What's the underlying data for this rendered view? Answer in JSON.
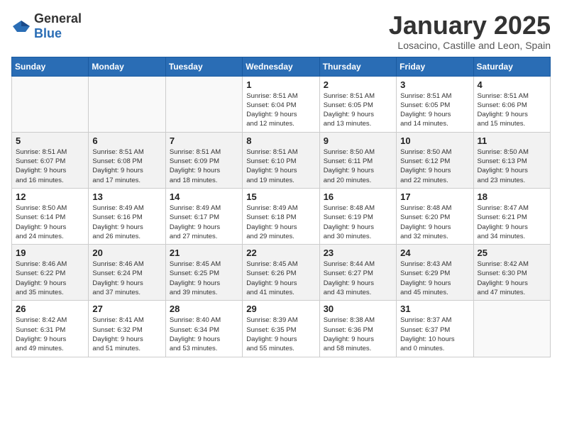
{
  "logo": {
    "general": "General",
    "blue": "Blue"
  },
  "header": {
    "month": "January 2025",
    "location": "Losacino, Castille and Leon, Spain"
  },
  "weekdays": [
    "Sunday",
    "Monday",
    "Tuesday",
    "Wednesday",
    "Thursday",
    "Friday",
    "Saturday"
  ],
  "weeks": [
    [
      {
        "day": "",
        "info": ""
      },
      {
        "day": "",
        "info": ""
      },
      {
        "day": "",
        "info": ""
      },
      {
        "day": "1",
        "info": "Sunrise: 8:51 AM\nSunset: 6:04 PM\nDaylight: 9 hours\nand 12 minutes."
      },
      {
        "day": "2",
        "info": "Sunrise: 8:51 AM\nSunset: 6:05 PM\nDaylight: 9 hours\nand 13 minutes."
      },
      {
        "day": "3",
        "info": "Sunrise: 8:51 AM\nSunset: 6:05 PM\nDaylight: 9 hours\nand 14 minutes."
      },
      {
        "day": "4",
        "info": "Sunrise: 8:51 AM\nSunset: 6:06 PM\nDaylight: 9 hours\nand 15 minutes."
      }
    ],
    [
      {
        "day": "5",
        "info": "Sunrise: 8:51 AM\nSunset: 6:07 PM\nDaylight: 9 hours\nand 16 minutes."
      },
      {
        "day": "6",
        "info": "Sunrise: 8:51 AM\nSunset: 6:08 PM\nDaylight: 9 hours\nand 17 minutes."
      },
      {
        "day": "7",
        "info": "Sunrise: 8:51 AM\nSunset: 6:09 PM\nDaylight: 9 hours\nand 18 minutes."
      },
      {
        "day": "8",
        "info": "Sunrise: 8:51 AM\nSunset: 6:10 PM\nDaylight: 9 hours\nand 19 minutes."
      },
      {
        "day": "9",
        "info": "Sunrise: 8:50 AM\nSunset: 6:11 PM\nDaylight: 9 hours\nand 20 minutes."
      },
      {
        "day": "10",
        "info": "Sunrise: 8:50 AM\nSunset: 6:12 PM\nDaylight: 9 hours\nand 22 minutes."
      },
      {
        "day": "11",
        "info": "Sunrise: 8:50 AM\nSunset: 6:13 PM\nDaylight: 9 hours\nand 23 minutes."
      }
    ],
    [
      {
        "day": "12",
        "info": "Sunrise: 8:50 AM\nSunset: 6:14 PM\nDaylight: 9 hours\nand 24 minutes."
      },
      {
        "day": "13",
        "info": "Sunrise: 8:49 AM\nSunset: 6:16 PM\nDaylight: 9 hours\nand 26 minutes."
      },
      {
        "day": "14",
        "info": "Sunrise: 8:49 AM\nSunset: 6:17 PM\nDaylight: 9 hours\nand 27 minutes."
      },
      {
        "day": "15",
        "info": "Sunrise: 8:49 AM\nSunset: 6:18 PM\nDaylight: 9 hours\nand 29 minutes."
      },
      {
        "day": "16",
        "info": "Sunrise: 8:48 AM\nSunset: 6:19 PM\nDaylight: 9 hours\nand 30 minutes."
      },
      {
        "day": "17",
        "info": "Sunrise: 8:48 AM\nSunset: 6:20 PM\nDaylight: 9 hours\nand 32 minutes."
      },
      {
        "day": "18",
        "info": "Sunrise: 8:47 AM\nSunset: 6:21 PM\nDaylight: 9 hours\nand 34 minutes."
      }
    ],
    [
      {
        "day": "19",
        "info": "Sunrise: 8:46 AM\nSunset: 6:22 PM\nDaylight: 9 hours\nand 35 minutes."
      },
      {
        "day": "20",
        "info": "Sunrise: 8:46 AM\nSunset: 6:24 PM\nDaylight: 9 hours\nand 37 minutes."
      },
      {
        "day": "21",
        "info": "Sunrise: 8:45 AM\nSunset: 6:25 PM\nDaylight: 9 hours\nand 39 minutes."
      },
      {
        "day": "22",
        "info": "Sunrise: 8:45 AM\nSunset: 6:26 PM\nDaylight: 9 hours\nand 41 minutes."
      },
      {
        "day": "23",
        "info": "Sunrise: 8:44 AM\nSunset: 6:27 PM\nDaylight: 9 hours\nand 43 minutes."
      },
      {
        "day": "24",
        "info": "Sunrise: 8:43 AM\nSunset: 6:29 PM\nDaylight: 9 hours\nand 45 minutes."
      },
      {
        "day": "25",
        "info": "Sunrise: 8:42 AM\nSunset: 6:30 PM\nDaylight: 9 hours\nand 47 minutes."
      }
    ],
    [
      {
        "day": "26",
        "info": "Sunrise: 8:42 AM\nSunset: 6:31 PM\nDaylight: 9 hours\nand 49 minutes."
      },
      {
        "day": "27",
        "info": "Sunrise: 8:41 AM\nSunset: 6:32 PM\nDaylight: 9 hours\nand 51 minutes."
      },
      {
        "day": "28",
        "info": "Sunrise: 8:40 AM\nSunset: 6:34 PM\nDaylight: 9 hours\nand 53 minutes."
      },
      {
        "day": "29",
        "info": "Sunrise: 8:39 AM\nSunset: 6:35 PM\nDaylight: 9 hours\nand 55 minutes."
      },
      {
        "day": "30",
        "info": "Sunrise: 8:38 AM\nSunset: 6:36 PM\nDaylight: 9 hours\nand 58 minutes."
      },
      {
        "day": "31",
        "info": "Sunrise: 8:37 AM\nSunset: 6:37 PM\nDaylight: 10 hours\nand 0 minutes."
      },
      {
        "day": "",
        "info": ""
      }
    ]
  ]
}
